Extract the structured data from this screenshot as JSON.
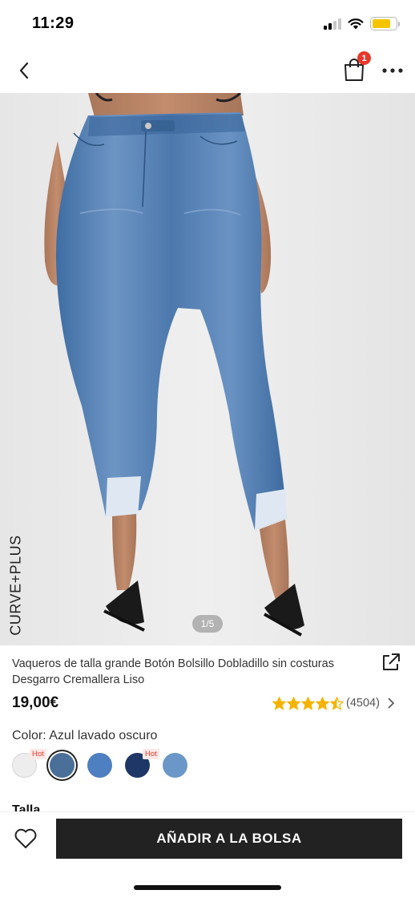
{
  "status_bar": {
    "time": "11:29",
    "signal_bars_active": 2,
    "signal_bars_total": 4,
    "battery_level": 0.8,
    "battery_color": "#f5c400"
  },
  "nav": {
    "back_icon": "chevron-left-icon",
    "bag_icon": "shopping-bag-icon",
    "bag_count": "1",
    "badge_color": "#e8382a",
    "more_icon": "ellipsis-icon"
  },
  "gallery": {
    "brand_tag": "CURVE+PLUS",
    "current_index": 1,
    "total": 5,
    "indicator": "1/5"
  },
  "product": {
    "title": "Vaqueros de talla grande Botón Bolsillo Dobladillo sin costuras Desgarro Cremallera Liso",
    "price": "19,00€",
    "rating_value": 4.5,
    "rating_count": "(4504)",
    "star_color": "#f5b301",
    "color_label": "Color: Azul lavado oscuro",
    "size_label": "Talla",
    "colors": [
      {
        "name": "blanco",
        "hex": "#ededed",
        "hot": true,
        "selected": false
      },
      {
        "name": "azul-lavado-oscuro",
        "hex": "#4a6f98",
        "hot": false,
        "selected": true
      },
      {
        "name": "azul-medio",
        "hex": "#4e7fc0",
        "hot": false,
        "selected": false
      },
      {
        "name": "azul-marino",
        "hex": "#1e3766",
        "hot": true,
        "selected": false
      },
      {
        "name": "azul-claro",
        "hex": "#6b97c8",
        "hot": false,
        "selected": false
      }
    ],
    "hot_label": "Hot"
  },
  "bottom_bar": {
    "wishlist_icon": "heart-outline-icon",
    "add_button_label": "AÑADIR A LA BOLSA",
    "button_color": "#222222"
  }
}
